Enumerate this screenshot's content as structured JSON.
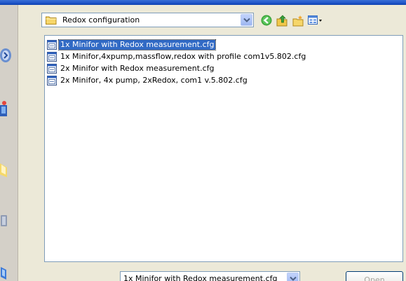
{
  "look_in": {
    "value": "Redox configuration"
  },
  "toolbar": {
    "back_icon": "back-arrow-icon",
    "up_icon": "up-folder-icon",
    "new_folder_icon": "new-folder-icon",
    "views_icon": "views-menu-icon"
  },
  "file_list": {
    "items": [
      {
        "label": "1x Minifor with Redox measurement.cfg",
        "selected": true
      },
      {
        "label": "1x Minifor,4xpump,massflow,redox with profile com1v5.802.cfg",
        "selected": false
      },
      {
        "label": "2x Minifor with Redox measurement.cfg",
        "selected": false
      },
      {
        "label": "2x Minifor, 4x pump, 2xRedox, com1 v.5.802.cfg",
        "selected": false
      }
    ]
  },
  "file_name": {
    "value": "1x Minifor with Redox measurement.cfg"
  },
  "open_button": {
    "label": "Open"
  },
  "colors": {
    "selection": "#316ac5",
    "border": "#7f9db9",
    "dialog_bg": "#ece9d8"
  }
}
